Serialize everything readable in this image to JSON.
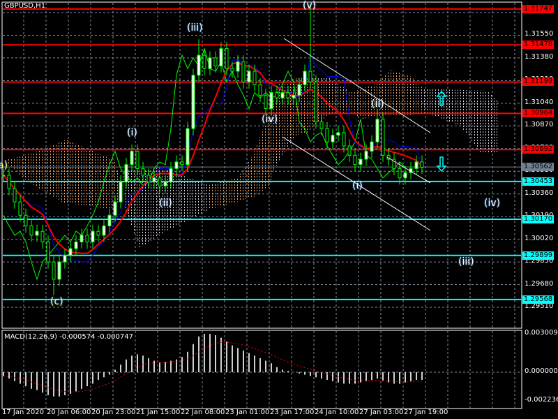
{
  "title": "GBPUSD,H1",
  "macd_label": "MACD(12,26,9) -0.000574 -0.000747",
  "colors": {
    "resistance": "#ff0000",
    "support": "#00ffff",
    "bull": "#00ff00",
    "grid": "#8090a0",
    "current": "#708090",
    "cloud_bear": "#f4a460",
    "cloud_bull": "#e0d0e0",
    "kijun": "#0000ff",
    "ma": "#ff0000"
  },
  "price_axis": [
    "1.31720",
    "1.31550",
    "1.31380",
    "1.31210",
    "1.31040",
    "1.30870",
    "1.30700",
    "1.30530",
    "1.30360",
    "1.30190",
    "1.30020",
    "1.29850",
    "1.29680",
    "1.29510"
  ],
  "resistance_levels": [
    "1.31747",
    "1.31478",
    "1.31199",
    "1.30964",
    "1.30692"
  ],
  "support_levels": [
    "1.30453",
    "1.30170",
    "1.29899",
    "1.29568"
  ],
  "current_price": "1.30562",
  "macd_axis": [
    "0.003009",
    "0.000000",
    "-0.002236"
  ],
  "time_axis": [
    "17 Jan 2020",
    "20 Jan 06:00",
    "20 Jan 23:00",
    "21 Jan 15:00",
    "22 Jan 08:00",
    "23 Jan 01:00",
    "23 Jan 17:00",
    "24 Jan 10:00",
    "27 Jan 03:00",
    "27 Jan 19:00"
  ],
  "waves": [
    {
      "text": "(iii)"
    },
    {
      "text": "(i)"
    },
    {
      "text": "(ii)"
    },
    {
      "text": "(iv)"
    },
    {
      "text": "(v)"
    },
    {
      "text": "(ii)"
    },
    {
      "text": "(i)"
    },
    {
      "text": "(iv)"
    },
    {
      "text": "(iii)"
    },
    {
      "text": "(c)"
    },
    {
      "text": "a)"
    }
  ],
  "chart_data": {
    "type": "candlestick",
    "symbol": "GBPUSD",
    "timeframe": "H1",
    "ylim": [
      1.2942,
      1.3182
    ],
    "closes": [
      1.305,
      1.304,
      1.303,
      1.302,
      1.3012,
      1.3005,
      1.3008,
      1.3,
      1.2985,
      1.2972,
      1.2985,
      1.299,
      1.2995,
      1.3,
      1.3005,
      1.3,
      1.3008,
      1.3005,
      1.3012,
      1.302,
      1.303,
      1.3045,
      1.3058,
      1.3068,
      1.3055,
      1.305,
      1.3045,
      1.3048,
      1.3042,
      1.3045,
      1.3055,
      1.306,
      1.3058,
      1.3085,
      1.3125,
      1.314,
      1.313,
      1.3138,
      1.3132,
      1.3145,
      1.313,
      1.3128,
      1.3135,
      1.312,
      1.3128,
      1.3118,
      1.311,
      1.31,
      1.3112,
      1.3108,
      1.3112,
      1.3108,
      1.311,
      1.3118,
      1.3128,
      1.312,
      1.309,
      1.3085,
      1.3075,
      1.308,
      1.3082,
      1.3072,
      1.3065,
      1.3058,
      1.3062,
      1.3068,
      1.3075,
      1.3092,
      1.3065,
      1.3062,
      1.3055,
      1.3048,
      1.3052,
      1.3055,
      1.306,
      1.3056
    ],
    "extremes": [
      {
        "index": 55,
        "high": 1.3178
      },
      {
        "index": 9,
        "low": 1.296
      },
      {
        "index": 35,
        "high": 1.3152
      },
      {
        "index": 67,
        "high": 1.31
      }
    ],
    "macd": {
      "ylim": [
        -0.002236,
        0.003009
      ],
      "main": [
        -0.0003,
        -0.0005,
        -0.0007,
        -0.0009,
        -0.0011,
        -0.0013,
        -0.0014,
        -0.0016,
        -0.0018,
        -0.0019,
        -0.0019,
        -0.0018,
        -0.0017,
        -0.0015,
        -0.0013,
        -0.0011,
        -0.0009,
        -0.0006,
        -0.0004,
        -0.0002,
        0.0002,
        0.0006,
        0.001,
        0.0013,
        0.0014,
        0.0013,
        0.0011,
        0.0009,
        0.0008,
        0.0008,
        0.0009,
        0.001,
        0.0012,
        0.0016,
        0.0022,
        0.0028,
        0.003,
        0.003,
        0.0029,
        0.0027,
        0.0024,
        0.0021,
        0.0019,
        0.0017,
        0.0015,
        0.0013,
        0.0011,
        0.0009,
        0.0007,
        0.0004,
        0.0002,
        0.0001,
        0.0,
        -0.0001,
        -0.0002,
        -0.0003,
        -0.0004,
        -0.0005,
        -0.0006,
        -0.0007,
        -0.0008,
        -0.0009,
        -0.0009,
        -0.0009,
        -0.0008,
        -0.0007,
        -0.0006,
        -0.0005,
        -0.0007,
        -0.0008,
        -0.0009,
        -0.0009,
        -0.0008,
        -0.0007,
        -0.0006,
        -0.0006
      ],
      "last_main": -0.000574,
      "last_signal": -0.000747
    }
  }
}
